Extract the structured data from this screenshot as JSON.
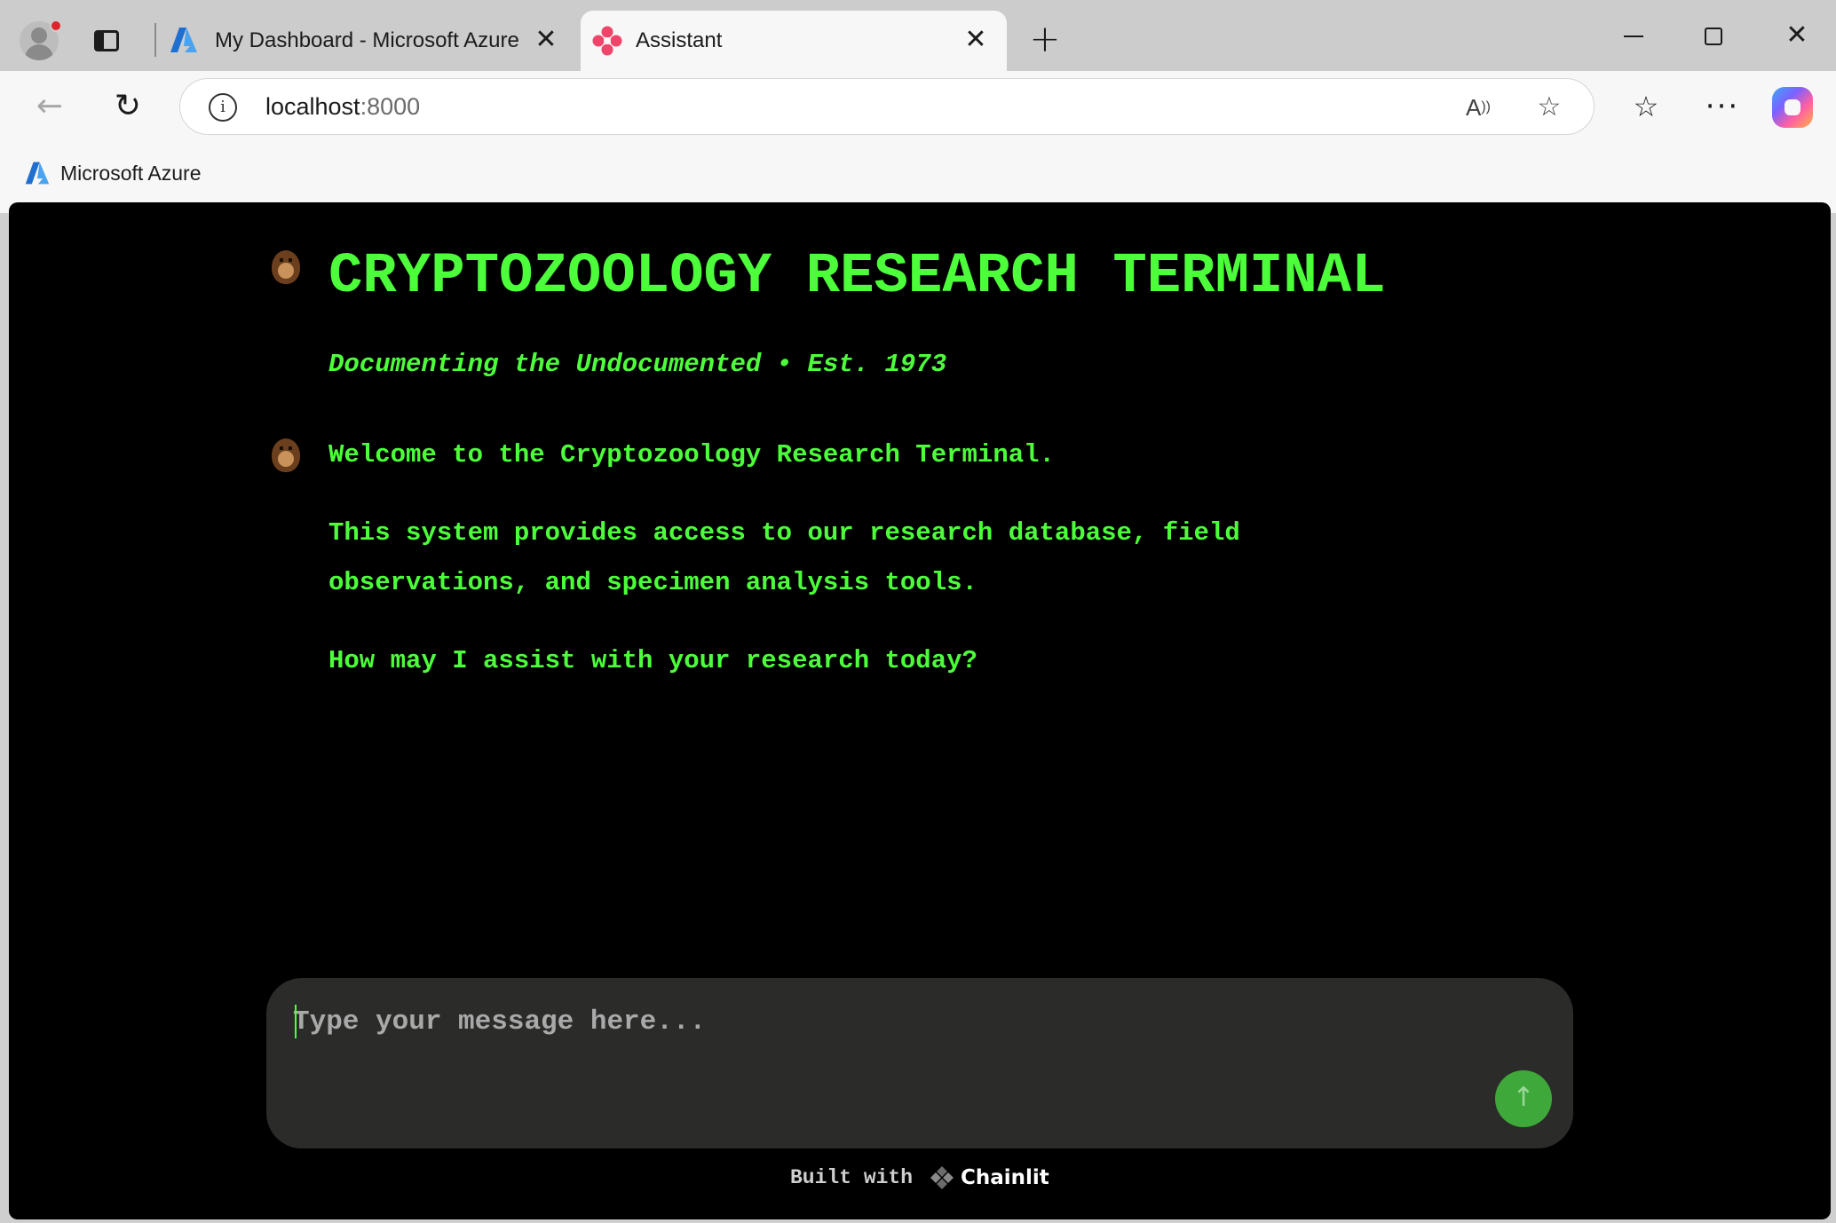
{
  "browser": {
    "tabs": [
      {
        "title": "My Dashboard - Microsoft Azure",
        "close": "✕"
      },
      {
        "title": "Assistant",
        "close": "✕"
      }
    ],
    "new_tab": "+",
    "url_host": "localhost",
    "url_port": ":8000",
    "bookmarks": [
      {
        "label": "Microsoft Azure"
      }
    ],
    "icons": {
      "back": "arrow-left-icon",
      "reload": "reload-icon",
      "info": "info-icon",
      "read_aloud": "read-aloud-icon",
      "favorite": "star-icon",
      "favorites": "favorites-icon",
      "more": "more-icon",
      "copilot": "copilot-icon"
    }
  },
  "app": {
    "title": "CRYPTOZOOLOGY RESEARCH TERMINAL",
    "subtitle": "Documenting the Undocumented • Est. 1973",
    "messages": [
      "Welcome to the Cryptozoology Research Terminal.",
      "This system provides access to our research database, field",
      "observations, and specimen analysis tools.",
      "How may I assist with your research today?"
    ],
    "composer": {
      "placeholder": "Type your message here...",
      "value": ""
    },
    "footer": {
      "built_with": "Built with",
      "brand": "Chainlit"
    },
    "colors": {
      "terminal_green": "#4cff3a",
      "background": "#000000",
      "composer_bg": "#2b2c2a",
      "send_button": "#3fa83a"
    }
  }
}
